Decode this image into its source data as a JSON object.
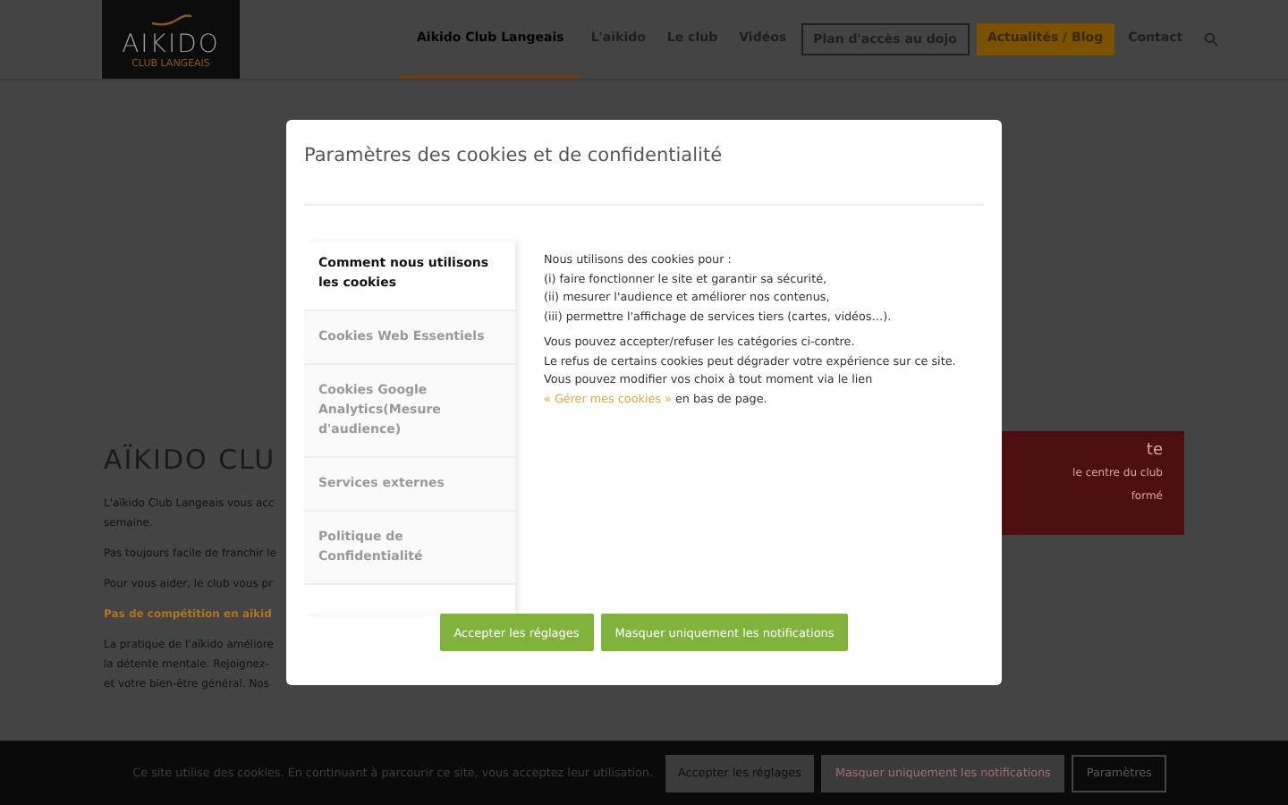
{
  "header": {
    "logo": {
      "title": "AIKIDO",
      "subtitle": "CLUB LANGEAIS"
    },
    "nav": [
      {
        "label": "Aikido Club Langeais",
        "kind": "link",
        "selected": true
      },
      {
        "label": "L'aïkido",
        "kind": "link",
        "selected": false
      },
      {
        "label": "Le club",
        "kind": "link",
        "selected": false
      },
      {
        "label": "Vidéos",
        "kind": "link",
        "selected": false
      },
      {
        "label": "Plan d'accès au dojo",
        "kind": "outline",
        "selected": false
      },
      {
        "label": "Actualités / Blog",
        "kind": "filled",
        "selected": false
      },
      {
        "label": "Contact",
        "kind": "link",
        "selected": false
      }
    ]
  },
  "page": {
    "heading": "AÏKIDO CLU",
    "paragraphs": [
      {
        "lines": [
          "L'aïkido Club Langeais vous acc",
          "semaine."
        ],
        "kind": "plain"
      },
      {
        "lines": [
          "Pas toujours facile de franchir le"
        ],
        "kind": "plain"
      },
      {
        "lines": [
          "Pour vous aider, le club vous pr"
        ],
        "kind": "plain"
      },
      {
        "lines": [
          "Pas de compétition en aïkid"
        ],
        "kind": "highlight"
      },
      {
        "lines": [
          "La pratique de l'aïkido améliore",
          "la détente mentale. Rejoignez-",
          "et votre bien-être général. Nos"
        ],
        "kind": "plain"
      }
    ],
    "aside": {
      "heading": "te",
      "lines": [
        "le centre du club",
        "formé"
      ]
    }
  },
  "modal": {
    "title": "Paramètres des cookies et de confidentialité",
    "tabs": [
      {
        "label": "Comment nous utilisons les cookies",
        "selected": true
      },
      {
        "label": "Cookies Web Essentiels",
        "selected": false
      },
      {
        "label": "Cookies Google Analytics(Mesure d'audience)",
        "selected": false
      },
      {
        "label": "Services externes",
        "selected": false
      },
      {
        "label": "Politique de Confidentialité",
        "selected": false
      }
    ],
    "content": {
      "intro": [
        "Nous utilisons des cookies pour :",
        "(i) faire fonctionner le site et garantir sa sécurité,",
        "(ii) mesurer l'audience et améliorer nos contenus,",
        "(iii) permettre l'affichage de services tiers (cartes, vidéos…)."
      ],
      "notice": [
        "Vous pouvez accepter/refuser les catégories ci-contre.",
        "Le refus de certains cookies peut dégrader votre expérience sur ce site.",
        "Vous pouvez modifier vos choix à tout moment via le lien"
      ],
      "link": "« Gérer mes cookies »",
      "link_after": "en bas de page."
    },
    "buttons": [
      "Accepter les réglages",
      "Masquer uniquement les notifications"
    ]
  },
  "cookie_bar": {
    "message": "Ce site utilise des cookies. En continuant à parcourir ce site, vous acceptez leur utilisation.",
    "buttons": [
      {
        "label": "Accepter les réglages",
        "kind": "plain"
      },
      {
        "label": "Masquer uniquement les notifications",
        "kind": "muted"
      },
      {
        "label": "Paramètres",
        "kind": "outline"
      }
    ]
  }
}
